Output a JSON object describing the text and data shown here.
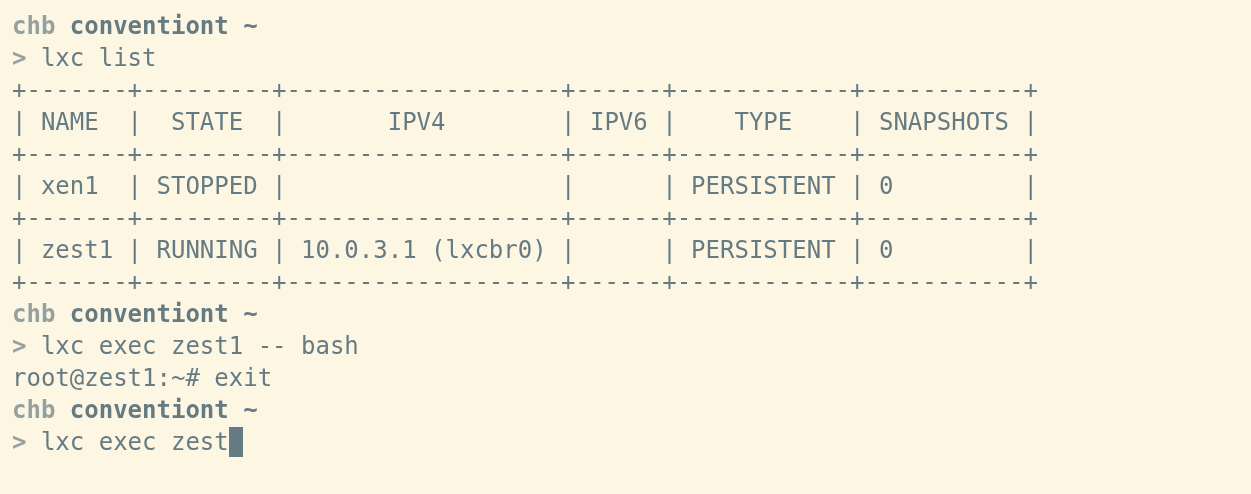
{
  "terminal": {
    "lines": [
      {
        "kind": "prompt",
        "user": "chb",
        "host": "conventiont",
        "dir": "~"
      },
      {
        "kind": "command",
        "symbol": ">",
        "text": "lxc list",
        "cursor": false
      },
      {
        "kind": "output",
        "text": "+-------+---------+-------------------+------+------------+-----------+"
      },
      {
        "kind": "output",
        "text": "| NAME  |  STATE  |       IPV4        | IPV6 |    TYPE    | SNAPSHOTS |"
      },
      {
        "kind": "output",
        "text": "+-------+---------+-------------------+------+------------+-----------+"
      },
      {
        "kind": "output",
        "text": "| xen1  | STOPPED |                   |      | PERSISTENT | 0         |"
      },
      {
        "kind": "output",
        "text": "+-------+---------+-------------------+------+------------+-----------+"
      },
      {
        "kind": "output",
        "text": "| zest1 | RUNNING | 10.0.3.1 (lxcbr0) |      | PERSISTENT | 0         |"
      },
      {
        "kind": "output",
        "text": "+-------+---------+-------------------+------+------------+-----------+"
      },
      {
        "kind": "prompt",
        "user": "chb",
        "host": "conventiont",
        "dir": "~"
      },
      {
        "kind": "command",
        "symbol": ">",
        "text": "lxc exec zest1 -- bash",
        "cursor": false
      },
      {
        "kind": "output",
        "text": "root@zest1:~# exit"
      },
      {
        "kind": "prompt",
        "user": "chb",
        "host": "conventiont",
        "dir": "~"
      },
      {
        "kind": "command",
        "symbol": ">",
        "text": "lxc exec zest",
        "cursor": true
      }
    ]
  }
}
